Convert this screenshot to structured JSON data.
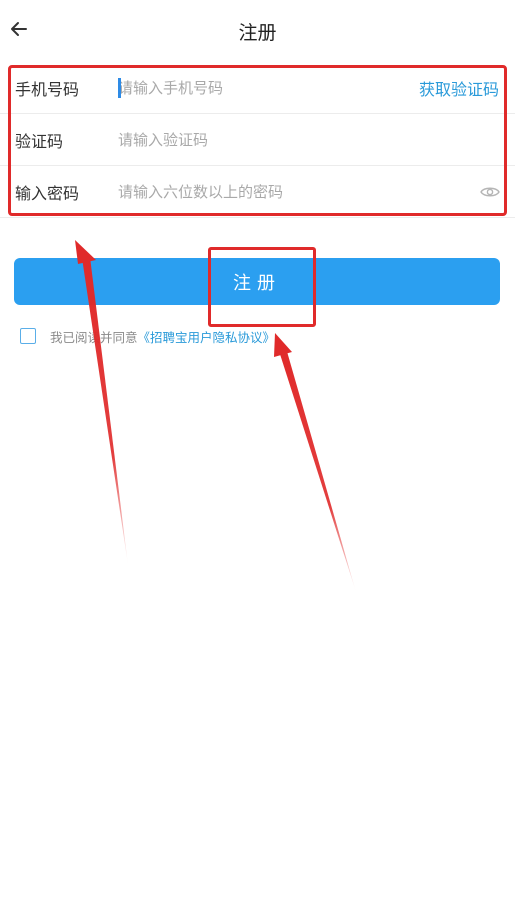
{
  "header": {
    "title": "注册",
    "back_icon": "arrow-left-icon"
  },
  "form": {
    "phone": {
      "label": "手机号码",
      "value": "",
      "placeholder": "请输入手机号码"
    },
    "get_code_label": "获取验证码",
    "code": {
      "label": "验证码",
      "value": "",
      "placeholder": "请输入验证码"
    },
    "password": {
      "label": "输入密码",
      "value": "",
      "placeholder": "请输入六位数以上的密码",
      "toggle_icon": "eye-icon"
    }
  },
  "register_button_label": "注册",
  "agreement": {
    "checked": false,
    "prefix": "我已阅读并同意",
    "link": "《招聘宝用户隐私协议》"
  },
  "colors": {
    "accent": "#2b9ff0",
    "link": "#2a9ad9",
    "annotation": "#e02a2a"
  }
}
